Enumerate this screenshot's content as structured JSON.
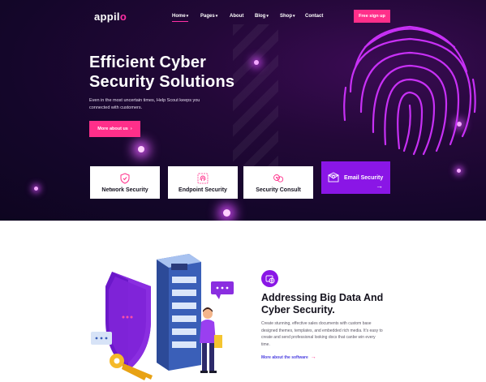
{
  "brand": {
    "name_main": "appil",
    "name_accent": "o"
  },
  "nav": {
    "items": [
      {
        "label": "Home",
        "caret": "▾"
      },
      {
        "label": "Pages",
        "caret": "▾"
      },
      {
        "label": "About",
        "caret": ""
      },
      {
        "label": "Blog",
        "caret": "▾"
      },
      {
        "label": "Shop",
        "caret": "▾"
      },
      {
        "label": "Contact",
        "caret": ""
      }
    ],
    "signup_label": "Free sign up"
  },
  "hero": {
    "title_line1": "Efficient Cyber",
    "title_line2": "Security Solutions",
    "subtitle": "Even in the most uncertain times, Help Scout keeps you connected with customers.",
    "cta_label": "More about us",
    "cta_arrow": "›"
  },
  "services": [
    {
      "label": "Network Security",
      "icon": "shield-icon"
    },
    {
      "label": "Endpoint Security",
      "icon": "fingerprint-icon"
    },
    {
      "label": "Security Consult",
      "icon": "consult-icon"
    },
    {
      "label": "Email Security",
      "icon": "email-icon",
      "arrow": "→"
    }
  ],
  "feature": {
    "icon": "globe-icon",
    "title_line1": "Addressing Big Data And",
    "title_line2": "Cyber Security.",
    "text": "Create stunning, effective sales documents with custom base designed themes, templates, and embedded rich media. It's easy to create and send professional looking docs that canbe win every time.",
    "link_label": "More about the software",
    "link_arrow": "→"
  },
  "colors": {
    "accent_pink": "#ff2f8a",
    "accent_purple": "#8a16e6",
    "hero_bg": "#1a0730"
  }
}
